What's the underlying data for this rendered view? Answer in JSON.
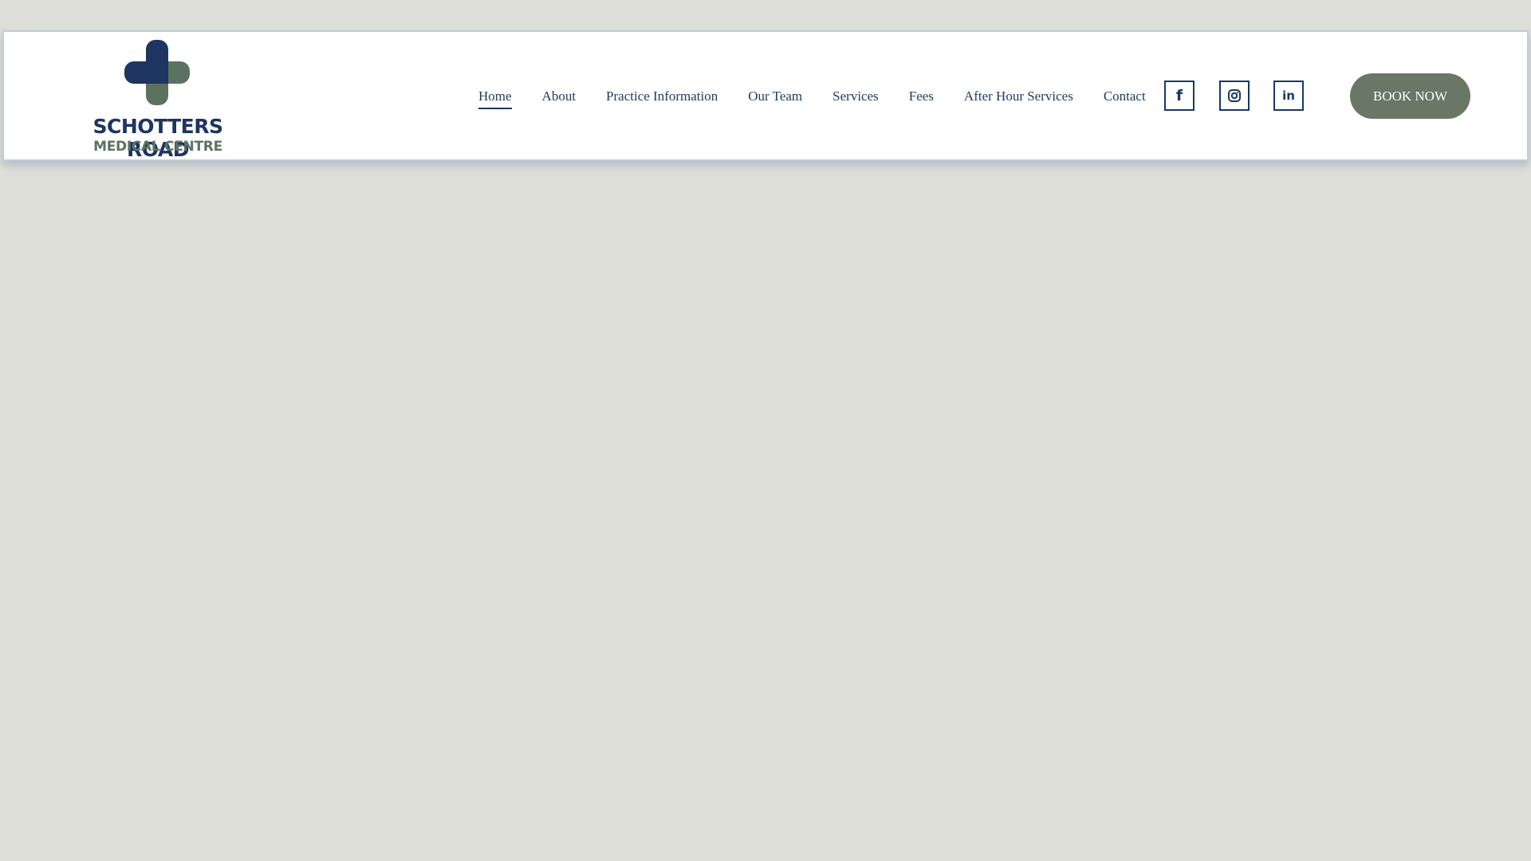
{
  "logo": {
    "line1": "SCHOTTERS ROAD",
    "line2": "MEDICAL CENTRE"
  },
  "nav": {
    "items": [
      {
        "label": "Home",
        "active": true
      },
      {
        "label": "About"
      },
      {
        "label": "Practice Information"
      },
      {
        "label": "Our Team"
      },
      {
        "label": "Services"
      },
      {
        "label": "Fees"
      },
      {
        "label": "After Hour Services"
      },
      {
        "label": "Contact"
      }
    ]
  },
  "social": [
    {
      "icon": "facebook-icon",
      "glyph": "f"
    },
    {
      "icon": "instagram-icon"
    },
    {
      "icon": "linkedin-icon",
      "glyph": "in"
    }
  ],
  "cta": {
    "label": "BOOK NOW"
  },
  "colors": {
    "navy": "#1e3461",
    "sage": "#6a7766",
    "background": "#dfdfda"
  }
}
